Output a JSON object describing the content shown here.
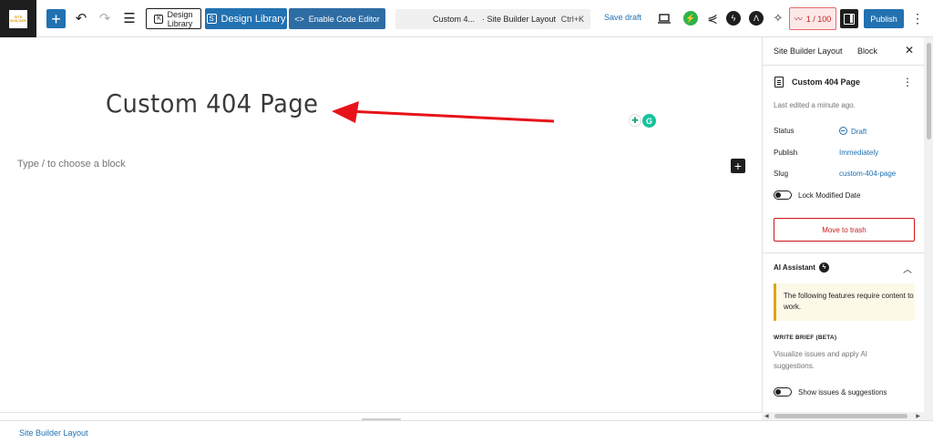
{
  "topbar": {
    "logo_text": "SITE BUILDER",
    "add_label": "+",
    "design_library_outline_line1": "Design",
    "design_library_outline_line2": "Library",
    "design_library_label": "Design Library",
    "code_editor_label": "Enable Code Editor",
    "command_title": "Custom 4...",
    "command_subtitle": "· Site Builder Layout",
    "command_shortcut": "Ctrl+K",
    "save_draft_label": "Save draft",
    "counter_label": "1 / 100",
    "publish_label": "Publish"
  },
  "canvas": {
    "page_title": "Custom 404 Page",
    "block_placeholder": "Type / to choose a block",
    "grammarly_letter": "G"
  },
  "sidebar": {
    "tab_layout": "Site Builder Layout",
    "tab_block": "Block",
    "doc_title": "Custom 404 Page",
    "last_edited": "Last edited a minute ago.",
    "status_label": "Status",
    "status_value": "Draft",
    "publish_label": "Publish",
    "publish_value": "Immediately",
    "slug_label": "Slug",
    "slug_value": "custom-404-page",
    "lock_modified_label": "Lock Modified Date",
    "trash_label": "Move to trash",
    "ai_assistant_label": "AI Assistant",
    "ai_notice": "The following features require content to work.",
    "write_brief_title": "WRITE BRIEF (BETA)",
    "write_brief_desc": "Visualize issues and apply AI suggestions.",
    "show_issues_label": "Show issues & suggestions"
  },
  "footer": {
    "breadcrumb": "Site Builder Layout"
  },
  "colors": {
    "accent": "#2271b1",
    "danger": "#cc1818",
    "arrow": "#e8121a",
    "notice_border": "#dba617"
  }
}
